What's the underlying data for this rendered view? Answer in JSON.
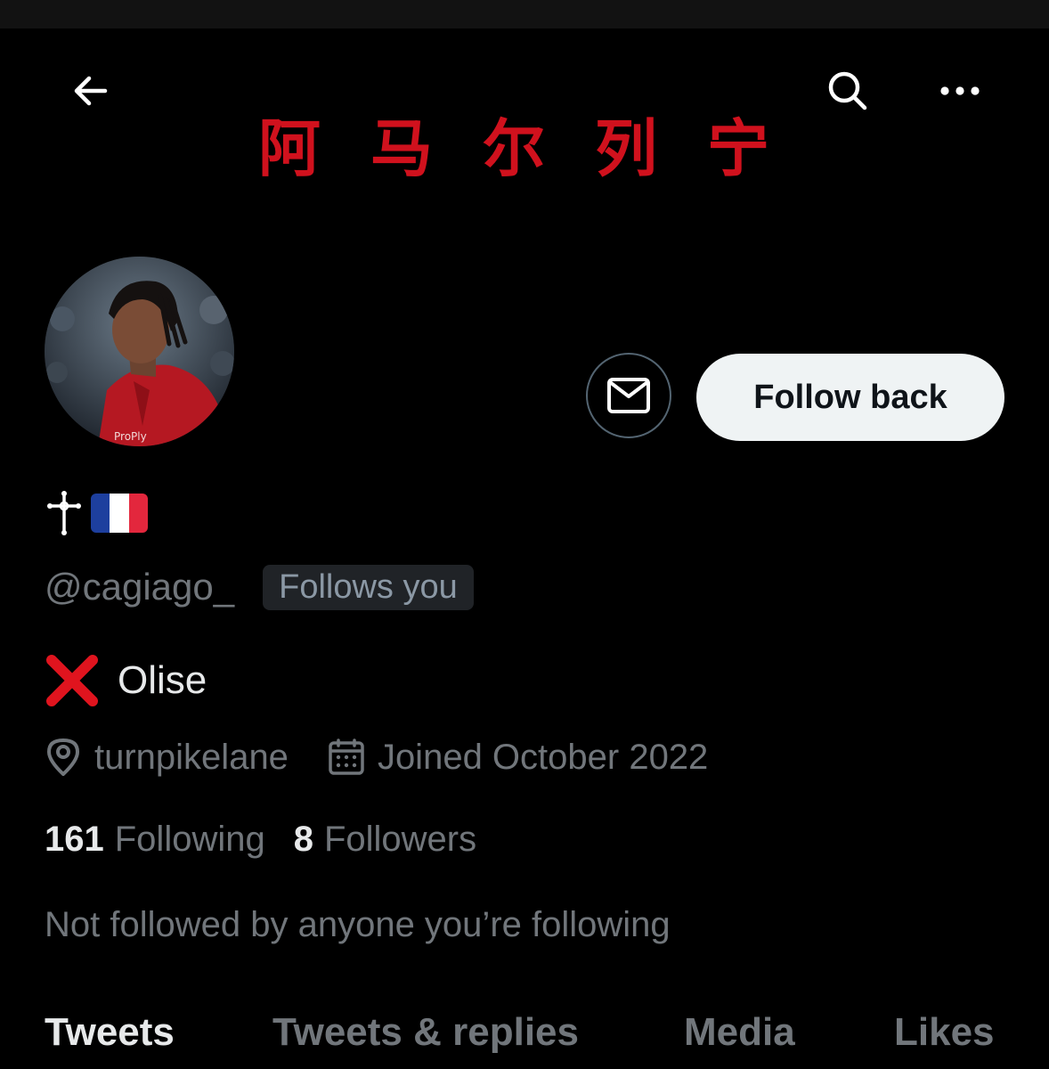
{
  "banner": {
    "title_chars": [
      "阿",
      "马",
      "尔",
      "列",
      "宁"
    ],
    "title_color": "#d0111d"
  },
  "nav": {
    "back_icon": "arrow-left-icon",
    "search_icon": "search-icon",
    "more_icon": "more-horizontal-icon"
  },
  "profile": {
    "display_name_icon": "cross-icon",
    "display_name_flag": "france-flag-icon",
    "handle": "@cagiago_",
    "follows_you_badge": "Follows you",
    "bio": {
      "emoji": "cross-mark-emoji",
      "text": "Olise"
    },
    "location": "turnpikelane",
    "joined": "Joined October 2022",
    "following_count": "161",
    "following_label": "Following",
    "followers_count": "8",
    "followers_label": "Followers",
    "not_followed_text": "Not followed by anyone you’re following"
  },
  "actions": {
    "follow_back_label": "Follow back",
    "message_icon": "mail-icon"
  },
  "tabs": [
    {
      "label": "Tweets",
      "active": true
    },
    {
      "label": "Tweets & replies",
      "active": false
    },
    {
      "label": "Media",
      "active": false
    },
    {
      "label": "Likes",
      "active": false
    }
  ],
  "colors": {
    "background": "#000000",
    "primary_text": "#e7e9ea",
    "secondary_text": "#71767b",
    "follow_button_bg": "#eff3f4",
    "accent_red": "#d0111d"
  }
}
